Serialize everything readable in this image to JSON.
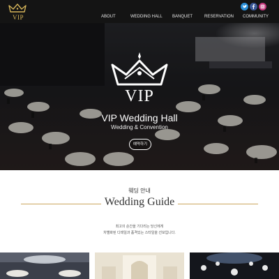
{
  "brand": {
    "logo_text": "VIP"
  },
  "nav": {
    "items": [
      "ABOUT",
      "WEDDING HALL",
      "BANQUET",
      "RESERVATION",
      "COMMUNITY"
    ]
  },
  "social": {
    "twitter": "twitter-icon",
    "facebook": "facebook-icon",
    "instagram": "instagram-icon"
  },
  "hero": {
    "logo_text": "VIP",
    "title": "VIP Wedding Hall",
    "subtitle": "Wedding & Convention",
    "button_label": "예약하기",
    "slides_total": 4,
    "active_slide": 2
  },
  "guide": {
    "title_kr": "웨딩 안내",
    "title_en": "Wedding Guide",
    "line1": "최고의 순간을 기다리는 당신에게",
    "line2": "차별화된 디테일과 품격있는 스타일을 선보입니다."
  },
  "colors": {
    "gold": "#c9a45a",
    "dark": "#141414"
  }
}
